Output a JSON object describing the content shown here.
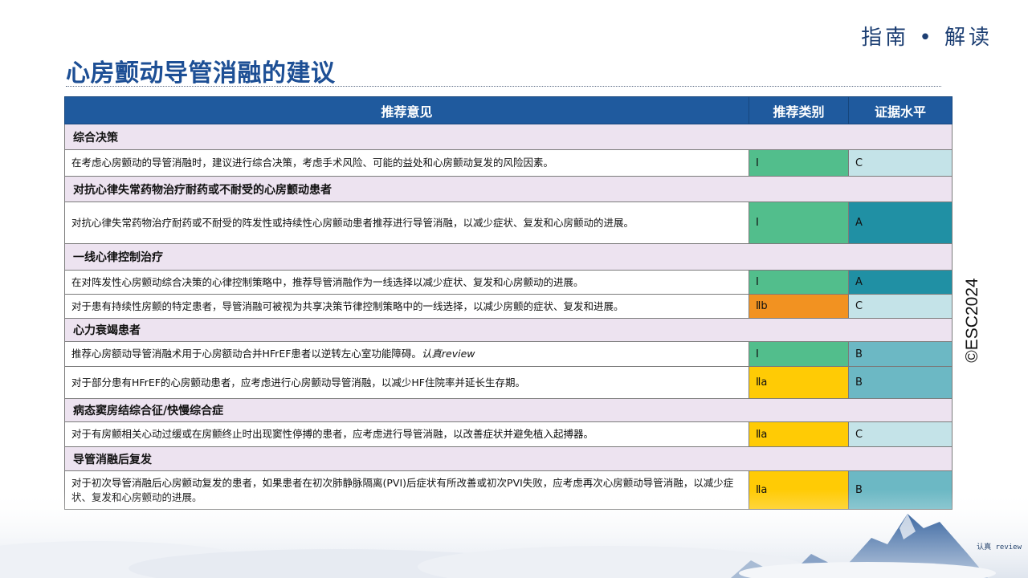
{
  "header": {
    "brand": "指南 • 解读",
    "title": "心房颤动导管消融的建议",
    "copyright": "©ESC2024",
    "watermark": "认真 review"
  },
  "table": {
    "columns": [
      "推荐意见",
      "推荐类别",
      "证据水平"
    ],
    "sections": [
      {
        "title": "综合决策",
        "rows": [
          {
            "text": "在考虑心房颤动的导管消融时，建议进行综合决策，考虑手术风险、可能的益处和心房颤动复发的风险因素。",
            "cls": "I",
            "level": "C"
          }
        ]
      },
      {
        "title": "对抗心律失常药物治疗耐药或不耐受的心房颤动患者",
        "rows": [
          {
            "text": "对抗心律失常药物治疗耐药或不耐受的阵发性或持续性心房颤动患者推荐进行导管消融，以减少症状、复发和心房颤动的进展。",
            "cls": "I",
            "level": "A"
          }
        ]
      },
      {
        "title": "一线心律控制治疗",
        "rows": [
          {
            "text": "在对阵发性心房颤动综合决策的心律控制策略中，推荐导管消融作为一线选择以减少症状、复发和心房颤动的进展。",
            "cls": "I",
            "level": "A"
          },
          {
            "text": "对于患有持续性房颤的特定患者，导管消融可被视为共享决策节律控制策略中的一线选择，以减少房颤的症状、复发和进展。",
            "cls": "Ⅱb",
            "level": "C"
          }
        ]
      },
      {
        "title": "心力衰竭患者",
        "rows": [
          {
            "text": "推荐心房额动导管消融术用于心房额动合并HFrEF患者以逆转左心室功能障碍。",
            "note": "认真review",
            "cls": "I",
            "level": "B"
          },
          {
            "text": "对于部分患有HFrEF的心房颤动患者，应考虑进行心房颤动导管消融，以减少HF住院率并延长生存期。",
            "cls": "Ⅱa",
            "level": "B"
          }
        ]
      },
      {
        "title": "病态窦房结综合征/快慢综合症",
        "rows": [
          {
            "text": "对于有房颤相关心动过缓或在房颤终止时出现窦性停搏的患者，应考虑进行导管消融，以改善症状并避免植入起搏器。",
            "cls": "Ⅱa",
            "level": "C"
          }
        ]
      },
      {
        "title": "导管消融后复发",
        "rows": [
          {
            "text": "对于初次导管消融后心房颤动复发的患者，如果患者在初次肺静脉隔离(PVI)后症状有所改善或初次PVI失败，应考虑再次心房颤动导管消融，以减少症状、复发和心房颤动的进展。",
            "cls": "Ⅱa",
            "level": "B"
          }
        ]
      }
    ]
  },
  "colors": {
    "header_bg": "#1f5a9e",
    "section_bg": "#ede3f0",
    "class_I": "#52be8c",
    "class_IIa": "#ffcb05",
    "class_IIb": "#f29221",
    "level_A": "#2090a4",
    "level_B": "#6cb8c4",
    "level_C": "#c4e3e8"
  }
}
